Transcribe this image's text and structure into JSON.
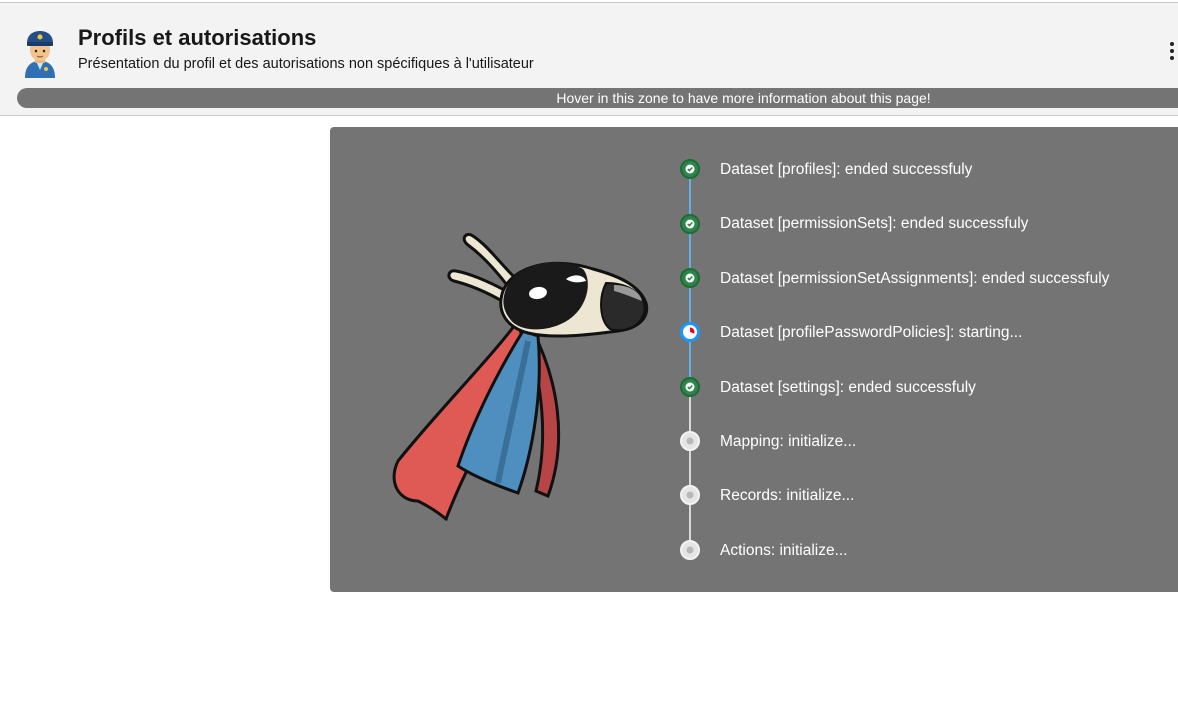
{
  "header": {
    "icon": "police-officer-icon",
    "title": "Profils et autorisations",
    "subtitle": "Présentation du profil et des autorisations non spécifiques à l'utilisateur",
    "menu_icon": "vertical-ellipsis-icon",
    "info_bar_text": "Hover in this zone to have more information about this page!"
  },
  "panel": {
    "mascot": "superhero-goat-mascot",
    "steps": [
      {
        "label": "Dataset [profiles]: ended successfuly",
        "status": "done"
      },
      {
        "label": "Dataset [permissionSets]: ended successfuly",
        "status": "done"
      },
      {
        "label": "Dataset [permissionSetAssignments]: ended successfuly",
        "status": "done"
      },
      {
        "label": "Dataset [profilePasswordPolicies]: starting...",
        "status": "active"
      },
      {
        "label": "Dataset [settings]: ended successfuly",
        "status": "done"
      },
      {
        "label": "Mapping: initialize...",
        "status": "pending"
      },
      {
        "label": "Records: initialize...",
        "status": "pending"
      },
      {
        "label": "Actions: initialize...",
        "status": "pending"
      }
    ]
  },
  "colors": {
    "header_bg": "#f3f3f3",
    "panel_bg": "#747474",
    "done": "#2e844a",
    "active": "#1b96ff",
    "pending": "#e5e5e5"
  }
}
